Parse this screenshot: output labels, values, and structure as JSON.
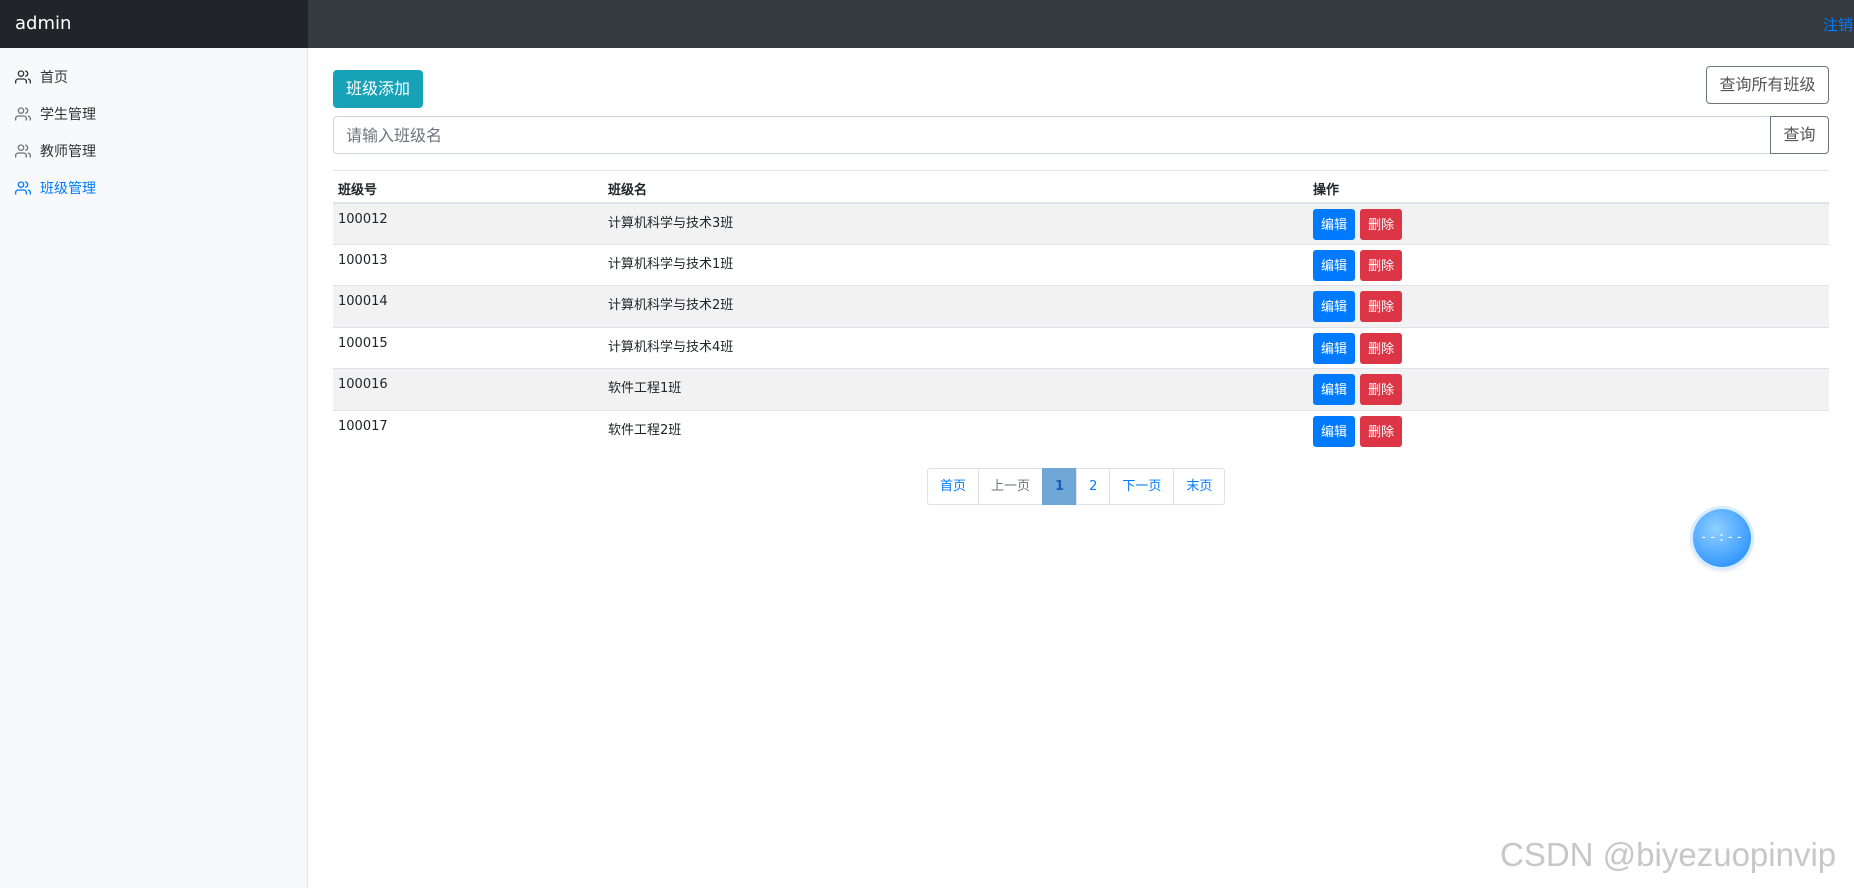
{
  "header": {
    "brand": "admin",
    "logout": "注销"
  },
  "sidebar": {
    "items": [
      {
        "label": "首页",
        "active": false,
        "icon": "users-icon"
      },
      {
        "label": "学生管理",
        "active": false,
        "icon": "users-icon"
      },
      {
        "label": "教师管理",
        "active": false,
        "icon": "users-icon"
      },
      {
        "label": "班级管理",
        "active": true,
        "icon": "users-icon"
      }
    ]
  },
  "toolbar": {
    "add_label": "班级添加",
    "query_all_label": "查询所有班级"
  },
  "search": {
    "placeholder": "请输入班级名",
    "value": "",
    "button_label": "查询"
  },
  "table": {
    "headers": [
      "班级号",
      "班级名",
      "操作"
    ],
    "rows": [
      {
        "id": "100012",
        "name": "计算机科学与技术3班",
        "edit": "编辑",
        "delete": "删除"
      },
      {
        "id": "100013",
        "name": "计算机科学与技术1班",
        "edit": "编辑",
        "delete": "删除"
      },
      {
        "id": "100014",
        "name": "计算机科学与技术2班",
        "edit": "编辑",
        "delete": "删除"
      },
      {
        "id": "100015",
        "name": "计算机科学与技术4班",
        "edit": "编辑",
        "delete": "删除"
      },
      {
        "id": "100016",
        "name": "软件工程1班",
        "edit": "编辑",
        "delete": "删除"
      },
      {
        "id": "100017",
        "name": "软件工程2班",
        "edit": "编辑",
        "delete": "删除"
      }
    ]
  },
  "pagination": {
    "first": "首页",
    "prev": "上一页",
    "pages": [
      "1",
      "2"
    ],
    "current": "1",
    "next": "下一页",
    "last": "末页"
  },
  "floating_widget": {
    "text": "--:--"
  },
  "watermark": "CSDN @biyezuopinvip",
  "colors": {
    "accent": "#007bff",
    "add_button": "#17a2b8",
    "delete": "#dc3545",
    "navbar": "#343a40"
  }
}
